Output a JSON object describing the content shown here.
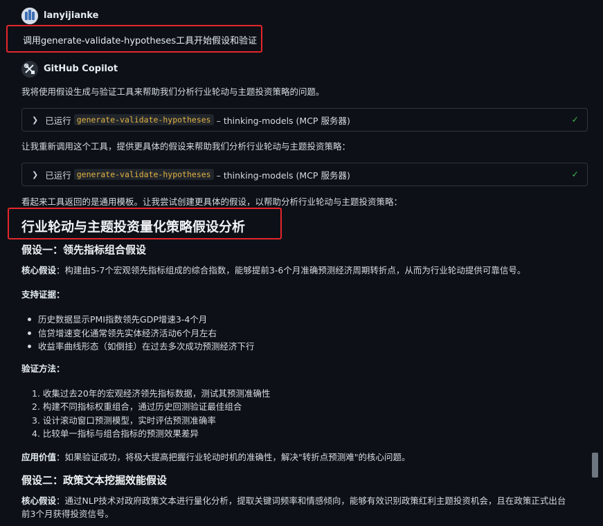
{
  "user": {
    "name": "lanyijianke",
    "message": "调用generate-validate-hypotheses工具开始假设和验证"
  },
  "assistant": {
    "name": "GitHub Copilot",
    "intro": "我将使用假设生成与验证工具来帮助我们分析行业轮动与主题投资策略的问题。",
    "tool_calls": [
      {
        "prefix": "已运行",
        "tool": "generate-validate-hypotheses",
        "suffix": "– thinking-models (MCP 服务器)"
      },
      {
        "prefix": "已运行",
        "tool": "generate-validate-hypotheses",
        "suffix": "– thinking-models (MCP 服务器)"
      }
    ],
    "retry_text": "让我重新调用这个工具，提供更具体的假设来帮助我们分析行业轮动与主题投资策略：",
    "followup_text": "看起来工具返回的是通用模板。让我尝试创建更具体的假设，以帮助分析行业轮动与主题投资策略：",
    "heading": "行业轮动与主题投资量化策略假设分析",
    "h1": {
      "title": "假设一：领先指标组合假设",
      "core_label": "核心假设",
      "core_text": "：构建由5-7个宏观领先指标组成的综合指数，能够提前3-6个月准确预测经济周期转折点，从而为行业轮动提供可靠信号。",
      "evidence_label": "支持证据",
      "evidence_colon": "：",
      "evidence": [
        "历史数据显示PMI指数领先GDP增速3-4个月",
        "信贷增速变化通常领先实体经济活动6个月左右",
        "收益率曲线形态（如倒挂）在过去多次成功预测经济下行"
      ],
      "method_label": "验证方法",
      "method_colon": "：",
      "methods": [
        "收集过去20年的宏观经济领先指标数据，测试其预测准确性",
        "构建不同指标权重组合，通过历史回测验证最佳组合",
        "设计滚动窗口预测模型，实时评估预测准确率",
        "比较单一指标与组合指标的预测效果差异"
      ],
      "method_nums": [
        "1.",
        "2.",
        "3.",
        "4."
      ],
      "value_label": "应用价值",
      "value_text": "：如果验证成功，将极大提高把握行业轮动时机的准确性，解决\"转折点预测难\"的核心问题。"
    },
    "h2": {
      "title": "假设二：政策文本挖掘效能假设",
      "core_label": "核心假设",
      "core_text_1": "：通过NLP技术对政府政策文本进行量化分析，提取关键词频率和情感倾向，能够有效识别政策红利主题投资机会，且在政策正式出台",
      "core_text_2": "前3个月获得投资信号。"
    }
  },
  "icons": {
    "expand": "chevron-right-icon",
    "done": "check-icon"
  },
  "colors": {
    "highlight_border": "#e5262b",
    "check": "#3fb950",
    "code": "#e3b341"
  }
}
